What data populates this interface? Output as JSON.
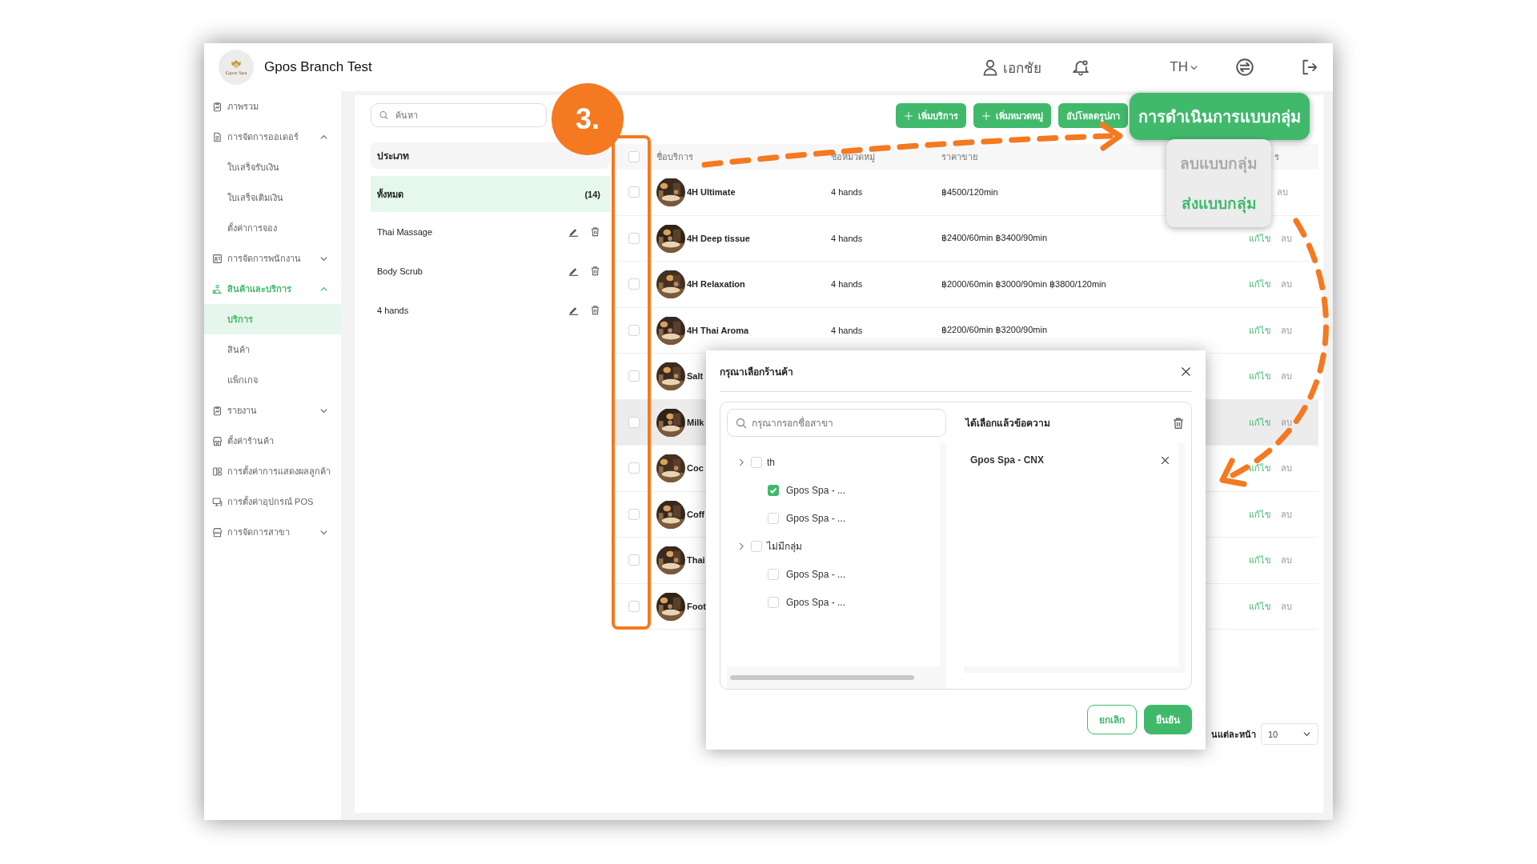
{
  "header": {
    "logo_text": "Gpos Spa",
    "title": "Gpos Branch Test",
    "user": "เอกชัย",
    "language": "TH"
  },
  "sidebar": {
    "items": [
      {
        "kind": "link",
        "label": "ภาพรวม",
        "selected": false
      },
      {
        "kind": "group",
        "label": "การจัดการออเดอร์",
        "selected": false,
        "expanded": true,
        "children": [
          {
            "label": "ใบเสร็จรับเงิน",
            "selected": false
          },
          {
            "label": "ใบเสร็จเติมเงิน",
            "selected": false
          },
          {
            "label": "ตั้งค่าการจอง",
            "selected": false
          }
        ]
      },
      {
        "kind": "group",
        "label": "การจัดการพนักงาน",
        "selected": false,
        "expanded": false
      },
      {
        "kind": "group",
        "label": "สินค้าและบริการ",
        "selected": true,
        "expanded": true,
        "children": [
          {
            "label": "บริการ",
            "selected": true
          },
          {
            "label": "สินค้า",
            "selected": false
          },
          {
            "label": "แพ็กเกจ",
            "selected": false
          }
        ]
      },
      {
        "kind": "group",
        "label": "รายงาน",
        "selected": false,
        "expanded": false
      },
      {
        "kind": "link",
        "label": "ตั้งค่าร้านค้า",
        "selected": false
      },
      {
        "kind": "link",
        "label": "การตั้งค่าการแสดงผลลูกค้า",
        "selected": false
      },
      {
        "kind": "link",
        "label": "การตั้งค่าอุปกรณ์ POS",
        "selected": false
      },
      {
        "kind": "group",
        "label": "การจัดการสาขา",
        "selected": false,
        "expanded": false
      }
    ]
  },
  "categories": {
    "search_placeholder": "ค้นหา",
    "heading": "ประเภท",
    "items": [
      {
        "label": "ทั้งหมด",
        "count": "(14)",
        "selected": true
      },
      {
        "label": "Thai Massage",
        "selected": false
      },
      {
        "label": "Body Scrub",
        "selected": false
      },
      {
        "label": "4 hands",
        "selected": false
      }
    ]
  },
  "toolbar": {
    "buttons": [
      {
        "label": "เพิ่มบริการ",
        "kind": "add"
      },
      {
        "label": "เพิ่มหมวดหมู่",
        "kind": "add"
      },
      {
        "label": "อัปโหลดรูปภา",
        "kind": "plain"
      }
    ]
  },
  "bulk_actions": {
    "label": "การดำเนินการแบบกลุ่ม",
    "menu": [
      {
        "label": "ลบแบบกลุ่ม",
        "disabled": true
      },
      {
        "label": "ส่งแบบกลุ่ม",
        "disabled": false
      }
    ]
  },
  "table": {
    "header_checked": false,
    "columns": [
      "ชื่อบริการ",
      "ชื่อหมวดหมู่",
      "ราคาขาย",
      "ร"
    ],
    "rows": [
      {
        "name": "4H Ultimate",
        "category": "4 hands",
        "price": "฿4500/120min",
        "delete": "ลบ",
        "checked": false,
        "hovered": false
      },
      {
        "name": "4H Deep tissue",
        "category": "4 hands",
        "price": "฿2400/60min ฿3400/90min",
        "edit": "แก้ไข",
        "delete": "ลบ",
        "checked": false,
        "hovered": false
      },
      {
        "name": "4H Relaxation",
        "category": "4 hands",
        "price": "฿2000/60min ฿3000/90min ฿3800/120min",
        "edit": "แก้ไข",
        "delete": "ลบ",
        "checked": false,
        "hovered": false
      },
      {
        "name": "4H Thai Aroma",
        "category": "4 hands",
        "price": "฿2200/60min ฿3200/90min",
        "edit": "แก้ไข",
        "delete": "ลบ",
        "checked": false,
        "hovered": false
      },
      {
        "name": "Salt",
        "edit": "แก้ไข",
        "delete": "ลบ",
        "checked": false,
        "hovered": false
      },
      {
        "name": "Milk",
        "edit": "แก้ไข",
        "delete": "ลบ",
        "checked": false,
        "hovered": true
      },
      {
        "name": "Coc",
        "edit": "แก้ไข",
        "delete": "ลบ",
        "checked": false,
        "hovered": false
      },
      {
        "name": "Coff",
        "edit": "แก้ไข",
        "delete": "ลบ",
        "checked": false,
        "hovered": false
      },
      {
        "name": "Thai",
        "edit": "แก้ไข",
        "delete": "ลบ",
        "checked": false,
        "hovered": false
      },
      {
        "name": "Foot",
        "edit": "แก้ไข",
        "delete": "ลบ",
        "checked": false,
        "hovered": false
      }
    ]
  },
  "pagination": {
    "label": "นแต่ละหน้า",
    "page_size": "10"
  },
  "dialog": {
    "title": "กรุณาเลือกร้านค้า",
    "search_placeholder": "กรุณากรอกชื่อสาขา",
    "tree": [
      {
        "label": "th",
        "checked": false,
        "children": [
          {
            "label": "Gpos Spa - ...",
            "checked": true
          },
          {
            "label": "Gpos Spa - ...",
            "checked": false
          }
        ]
      },
      {
        "label": "ไม่มีกลุ่ม",
        "checked": false,
        "children": [
          {
            "label": "Gpos Spa - ...",
            "checked": false
          },
          {
            "label": "Gpos Spa - ...",
            "checked": false
          }
        ]
      }
    ],
    "selected_heading": "ได้เลือกแล้วข้อความ",
    "selected_items": [
      "Gpos Spa - CNX"
    ],
    "buttons": [
      {
        "label": "ยกเลิก",
        "kind": "secondary"
      },
      {
        "label": "ยืนยัน",
        "kind": "primary"
      }
    ]
  },
  "annotation": {
    "step": "3."
  }
}
